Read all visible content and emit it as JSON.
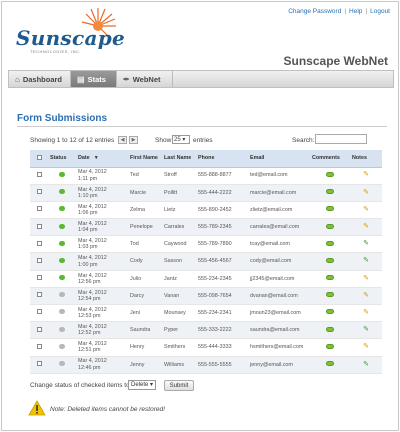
{
  "top_links": [
    "Change Password",
    "Help",
    "Logout"
  ],
  "logo": {
    "text": "Sunscape",
    "tagline": "TECHNOLOGIES, INC."
  },
  "app_title": "Sunscape WebNet",
  "tabs": [
    {
      "label": "Dashboard",
      "icon": "home-icon",
      "active": false
    },
    {
      "label": "Stats",
      "icon": "chart-icon",
      "active": true
    },
    {
      "label": "WebNet",
      "icon": "wrench-icon",
      "active": false
    }
  ],
  "page_heading": "Form Submissions",
  "controls": {
    "info": "Showing 1 to 12 of 12 entries",
    "show_label": "Show",
    "show_value": "25",
    "entries_label": "entries",
    "search_label": "Search:"
  },
  "table": {
    "headers": [
      "",
      "Status",
      "Date",
      "First Name",
      "Last Name",
      "Phone",
      "Email",
      "Comments",
      "Notes"
    ],
    "rows": [
      {
        "status": "green",
        "date": "Mar 4, 2012",
        "time": "1:11 pm",
        "first": "Ted",
        "last": "Stroff",
        "phone": "555-888-8877",
        "email": "ted@email.com",
        "note": "orange"
      },
      {
        "status": "green",
        "date": "Mar 4, 2012",
        "time": "1:10 pm",
        "first": "Marcie",
        "last": "Pollitt",
        "phone": "555-444-2222",
        "email": "marcie@email.com",
        "note": "orange"
      },
      {
        "status": "green",
        "date": "Mar 4, 2012",
        "time": "1:06 pm",
        "first": "Zelma",
        "last": "Lietz",
        "phone": "555-890-2452",
        "email": "zlietz@email.com",
        "note": "orange"
      },
      {
        "status": "green",
        "date": "Mar 4, 2012",
        "time": "1:04 pm",
        "first": "Penelope",
        "last": "Carrales",
        "phone": "555-789-2345",
        "email": "carrales@email.com",
        "note": "orange"
      },
      {
        "status": "green",
        "date": "Mar 4, 2012",
        "time": "1:03 pm",
        "first": "Tod",
        "last": "Caywood",
        "phone": "555-789-7890",
        "email": "tcay@email.com",
        "note": "green"
      },
      {
        "status": "green",
        "date": "Mar 4, 2012",
        "time": "1:00 pm",
        "first": "Cody",
        "last": "Sasson",
        "phone": "555-456-4567",
        "email": "cody@email.com",
        "note": "green"
      },
      {
        "status": "green",
        "date": "Mar 4, 2012",
        "time": "12:56 pm",
        "first": "Julio",
        "last": "Jantz",
        "phone": "555-234-2345",
        "email": "jj2345@email.com",
        "note": "orange"
      },
      {
        "status": "gray",
        "date": "Mar 4, 2012",
        "time": "12:54 pm",
        "first": "Darcy",
        "last": "Vanan",
        "phone": "555-098-7654",
        "email": "dvanan@email.com",
        "note": "orange"
      },
      {
        "status": "gray",
        "date": "Mar 4, 2012",
        "time": "12:53 pm",
        "first": "Jeni",
        "last": "Mounsey",
        "phone": "555-234-2341",
        "email": "jmoun23@email.com",
        "note": "orange"
      },
      {
        "status": "gray",
        "date": "Mar 4, 2012",
        "time": "12:52 pm",
        "first": "Saundra",
        "last": "Pyper",
        "phone": "555-333-2222",
        "email": "saundra@email.com",
        "note": "green"
      },
      {
        "status": "gray",
        "date": "Mar 4, 2012",
        "time": "12:51 pm",
        "first": "Henry",
        "last": "Smithers",
        "phone": "555-444-3333",
        "email": "hsmithers@email.com",
        "note": "orange"
      },
      {
        "status": "gray",
        "date": "Mar 4, 2012",
        "time": "12:46 pm",
        "first": "Jenny",
        "last": "Williams",
        "phone": "555-555-5555",
        "email": "jenny@email.com",
        "note": "green"
      }
    ]
  },
  "bulk": {
    "label": "Change status of checked items to:",
    "select_value": "Delete",
    "submit_label": "Submit"
  },
  "warning_text": "Note: Deleted items cannot be restored!",
  "colors": {
    "accent": "#2a6fb0",
    "status_green": "#5cb82e",
    "status_gray": "#b8b8b8",
    "header_bg": "#d7e3f0"
  }
}
